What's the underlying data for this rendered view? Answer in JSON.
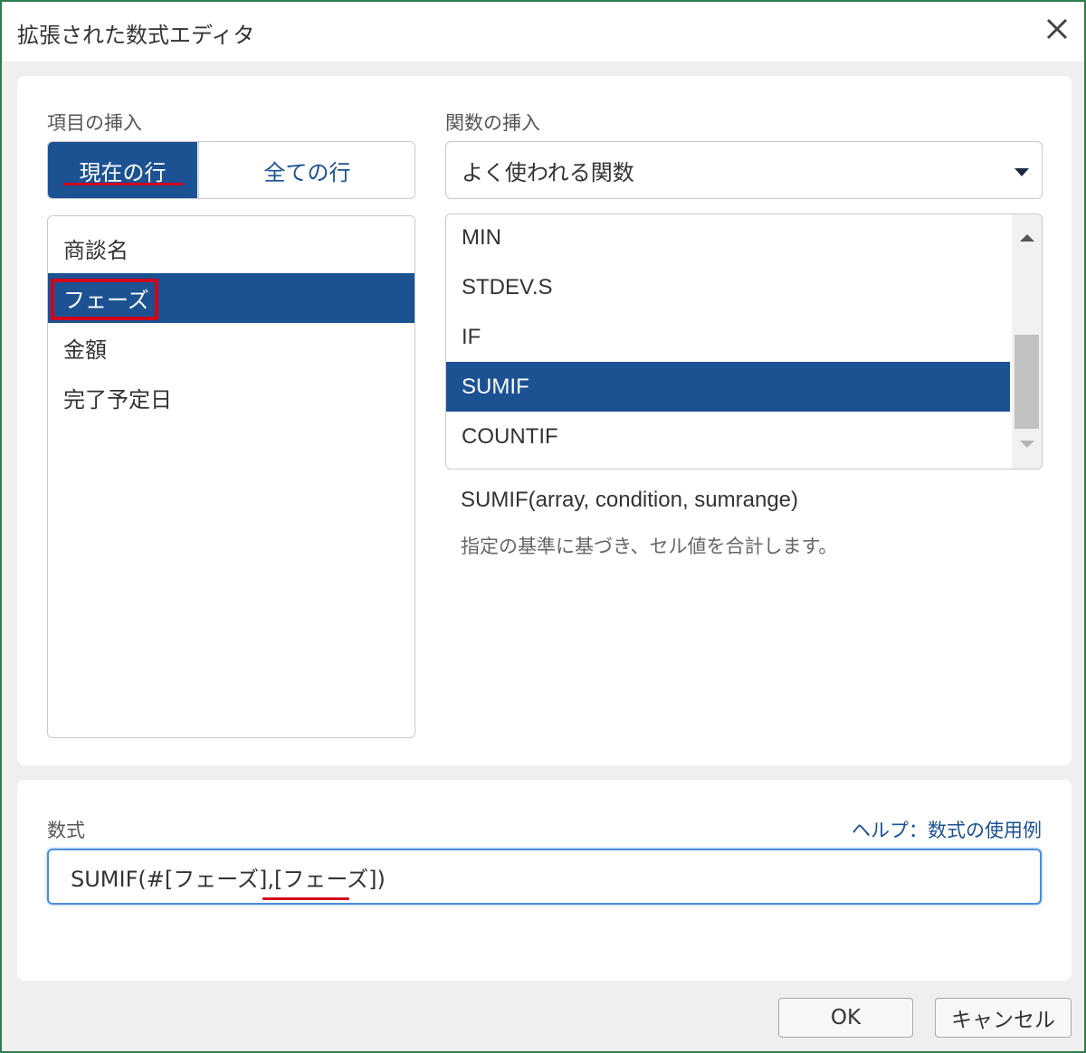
{
  "window": {
    "title": "拡張された数式エディタ",
    "close_icon": "close-icon"
  },
  "insert_field": {
    "label": "項目の挿入",
    "tabs": [
      {
        "label": "現在の行",
        "selected": true
      },
      {
        "label": "全ての行",
        "selected": false
      }
    ],
    "items": [
      {
        "label": "商談名",
        "selected": false
      },
      {
        "label": "フェーズ",
        "selected": true
      },
      {
        "label": "金額",
        "selected": false
      },
      {
        "label": "完了予定日",
        "selected": false
      }
    ]
  },
  "insert_function": {
    "label": "関数の挿入",
    "category_selected": "よく使われる関数",
    "items": [
      {
        "label": "MIN",
        "selected": false
      },
      {
        "label": "STDEV.S",
        "selected": false
      },
      {
        "label": "IF",
        "selected": false
      },
      {
        "label": "SUMIF",
        "selected": true
      },
      {
        "label": "COUNTIF",
        "selected": false
      }
    ],
    "signature": "SUMIF(array, condition, sumrange)",
    "description": "指定の基準に基づき、セル値を合計します。"
  },
  "formula": {
    "label": "数式",
    "help_link": "ヘルプ：数式の使用例",
    "value": "SUMIF(#[フェーズ],[フェーズ])"
  },
  "footer": {
    "ok_label": "OK",
    "cancel_label": "キャンセル"
  },
  "colors": {
    "accent": "#1c5192",
    "highlight_red": "#d0021b",
    "frame_green": "#2e7d4f"
  }
}
